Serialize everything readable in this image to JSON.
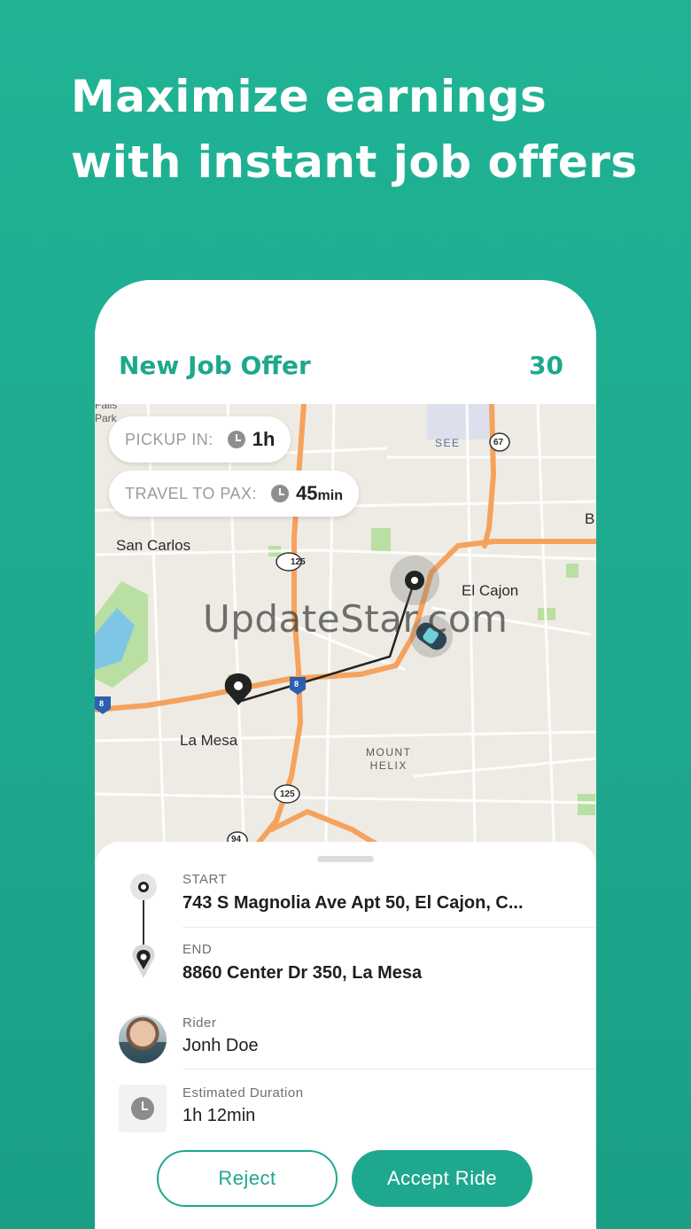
{
  "headline": {
    "line1": "Maximize earnings",
    "line2": "with instant job offers"
  },
  "offer": {
    "title": "New Job Offer",
    "count": "30"
  },
  "map": {
    "pickup_label": "PICKUP IN:",
    "pickup_value": "1h",
    "travel_label": "TRAVEL TO PAX:",
    "travel_value_number": "45",
    "travel_value_unit": "min",
    "places": {
      "san_carlos": "San Carlos",
      "el_cajon": "El Cajon",
      "la_mesa": "La Mesa",
      "mount_helix_1": "MOUNT",
      "mount_helix_2": "HELIX",
      "see": "SEE",
      "falls_park_1": "Falls",
      "falls_park_2": "Park",
      "b": "B"
    },
    "route_shields": {
      "r125a": "125",
      "r125b": "125",
      "r67": "67",
      "r94": "94",
      "i8a": "8",
      "i8b": "8"
    },
    "watermark": "UpdateStar.com"
  },
  "trip": {
    "start_label": "START",
    "start_value": "743 S Magnolia Ave Apt 50, El Cajon, C...",
    "end_label": "END",
    "end_value": "8860 Center Dr 350, La Mesa",
    "rider_label": "Rider",
    "rider_value": "Jonh Doe",
    "duration_label": "Estimated Duration",
    "duration_value": "1h 12min"
  },
  "actions": {
    "reject": "Reject",
    "accept": "Accept Ride"
  },
  "colors": {
    "brand": "#1ea88e",
    "road": "#f5a25d",
    "park": "#b9dfa3",
    "water": "#7fc6e6"
  }
}
